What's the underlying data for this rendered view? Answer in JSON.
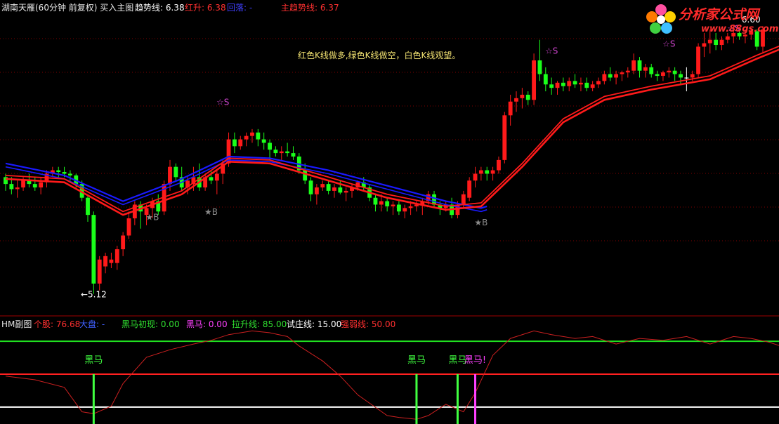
{
  "header": {
    "title": "湖南天雁(60分钟 前复权) 买入主图",
    "trend_label": "趋势线: 6.38",
    "red_up_label": "红升: 6.38",
    "fall_label": "回落: -",
    "main_trend_label": "主趋势线: 6.37"
  },
  "logo": {
    "text": "分析家公式网",
    "url": "www.88gs.com"
  },
  "annotation": "红色K线做多,绿色K线做空，白色K线观望。",
  "sub_header": {
    "title": "HM副图",
    "stock": "个股: 76.68",
    "market": "大盘: -",
    "first_appear": "黑马初现: 0.00",
    "dark_horse": "黑马: 0.00",
    "pull_up": "拉升线: 85.00",
    "test_zhuang": "试庄线: 15.00",
    "strength": "强弱线: 50.00"
  },
  "colors": {
    "up": "#ff1a1a",
    "down": "#1aff1a",
    "neutral": "#ffffff",
    "trend": "#1a1aff",
    "main_trend": "#ff1a1a",
    "grid": "#800000",
    "signal": "#cc44cc",
    "buy_mark": "#8a8a8a",
    "strength_line": "#cc2020",
    "level_high": "#20e020",
    "level_mid": "#ff2020",
    "level_low": "#ffffff",
    "dark_horse_signal": "#40ff40",
    "dark_horse_bang": "#ff40ff"
  },
  "chart_data": [
    {
      "type": "candlestick",
      "name": "main",
      "ylim": [
        5.0,
        6.75
      ],
      "ohlc": [
        [
          5.8,
          5.82,
          5.72,
          5.76
        ],
        [
          5.76,
          5.8,
          5.7,
          5.73
        ],
        [
          5.73,
          5.78,
          5.68,
          5.74
        ],
        [
          5.74,
          5.8,
          5.72,
          5.78
        ],
        [
          5.78,
          5.82,
          5.74,
          5.76
        ],
        [
          5.76,
          5.8,
          5.72,
          5.74
        ],
        [
          5.74,
          5.8,
          5.7,
          5.77
        ],
        [
          5.77,
          5.84,
          5.74,
          5.82
        ],
        [
          5.82,
          5.86,
          5.8,
          5.84
        ],
        [
          5.84,
          5.86,
          5.8,
          5.83
        ],
        [
          5.83,
          5.86,
          5.8,
          5.82
        ],
        [
          5.82,
          5.84,
          5.78,
          5.81
        ],
        [
          5.81,
          5.82,
          5.74,
          5.76
        ],
        [
          5.76,
          5.78,
          5.66,
          5.68
        ],
        [
          5.68,
          5.7,
          5.54,
          5.58
        ],
        [
          5.58,
          5.6,
          5.12,
          5.18
        ],
        [
          5.18,
          5.34,
          5.14,
          5.32
        ],
        [
          5.28,
          5.36,
          5.24,
          5.34
        ],
        [
          5.3,
          5.36,
          5.27,
          5.32
        ],
        [
          5.3,
          5.4,
          5.26,
          5.38
        ],
        [
          5.38,
          5.48,
          5.34,
          5.46
        ],
        [
          5.46,
          5.6,
          5.44,
          5.56
        ],
        [
          5.56,
          5.66,
          5.52,
          5.64
        ],
        [
          5.64,
          5.66,
          5.5,
          5.6
        ],
        [
          5.58,
          5.64,
          5.52,
          5.62
        ],
        [
          5.62,
          5.68,
          5.56,
          5.66
        ],
        [
          5.66,
          5.7,
          5.58,
          5.6
        ],
        [
          5.6,
          5.78,
          5.58,
          5.76
        ],
        [
          5.76,
          5.9,
          5.72,
          5.86
        ],
        [
          5.86,
          5.88,
          5.78,
          5.8
        ],
        [
          5.8,
          5.86,
          5.72,
          5.74
        ],
        [
          5.74,
          5.8,
          5.7,
          5.78
        ],
        [
          5.76,
          5.86,
          5.72,
          5.8
        ],
        [
          5.8,
          5.88,
          5.72,
          5.74
        ],
        [
          5.74,
          5.82,
          5.72,
          5.8
        ],
        [
          5.8,
          5.84,
          5.76,
          5.78
        ],
        [
          5.78,
          5.84,
          5.7,
          5.82
        ],
        [
          5.82,
          5.9,
          5.76,
          5.88
        ],
        [
          5.88,
          6.06,
          5.86,
          6.02
        ],
        [
          6.02,
          6.06,
          5.94,
          5.98
        ],
        [
          5.98,
          6.04,
          5.96,
          6.02
        ],
        [
          6.02,
          6.06,
          5.98,
          6.04
        ],
        [
          6.04,
          6.08,
          6.0,
          6.06
        ],
        [
          6.06,
          6.08,
          5.98,
          6.02
        ],
        [
          6.02,
          6.06,
          5.96,
          6.0
        ],
        [
          6.0,
          6.02,
          5.9,
          5.96
        ],
        [
          5.96,
          5.98,
          5.92,
          5.94
        ],
        [
          5.94,
          5.98,
          5.9,
          5.95
        ],
        [
          5.95,
          6.0,
          5.92,
          5.94
        ],
        [
          5.94,
          5.98,
          5.9,
          5.92
        ],
        [
          5.92,
          5.94,
          5.82,
          5.84
        ],
        [
          5.84,
          5.88,
          5.76,
          5.78
        ],
        [
          5.78,
          5.8,
          5.66,
          5.7
        ],
        [
          5.7,
          5.76,
          5.64,
          5.74
        ],
        [
          5.74,
          5.78,
          5.72,
          5.76
        ],
        [
          5.76,
          5.78,
          5.7,
          5.72
        ],
        [
          5.72,
          5.76,
          5.68,
          5.74
        ],
        [
          5.74,
          5.78,
          5.7,
          5.71
        ],
        [
          5.71,
          5.74,
          5.66,
          5.72
        ],
        [
          5.72,
          5.76,
          5.68,
          5.74
        ],
        [
          5.74,
          5.78,
          5.72,
          5.77
        ],
        [
          5.77,
          5.8,
          5.72,
          5.74
        ],
        [
          5.74,
          5.76,
          5.66,
          5.68
        ],
        [
          5.68,
          5.7,
          5.6,
          5.64
        ],
        [
          5.64,
          5.7,
          5.6,
          5.66
        ],
        [
          5.66,
          5.68,
          5.6,
          5.63
        ],
        [
          5.63,
          5.66,
          5.58,
          5.64
        ],
        [
          5.64,
          5.66,
          5.58,
          5.6
        ],
        [
          5.6,
          5.64,
          5.56,
          5.62
        ],
        [
          5.62,
          5.66,
          5.58,
          5.63
        ],
        [
          5.63,
          5.66,
          5.6,
          5.64
        ],
        [
          5.64,
          5.68,
          5.58,
          5.66
        ],
        [
          5.66,
          5.72,
          5.64,
          5.7
        ],
        [
          5.7,
          5.72,
          5.62,
          5.64
        ],
        [
          5.64,
          5.66,
          5.58,
          5.62
        ],
        [
          5.62,
          5.66,
          5.6,
          5.64
        ],
        [
          5.64,
          5.68,
          5.56,
          5.58
        ],
        [
          5.58,
          5.66,
          5.56,
          5.64
        ],
        [
          5.64,
          5.72,
          5.62,
          5.7
        ],
        [
          5.68,
          5.8,
          5.66,
          5.78
        ],
        [
          5.78,
          5.86,
          5.74,
          5.82
        ],
        [
          5.82,
          5.86,
          5.78,
          5.84
        ],
        [
          5.84,
          5.86,
          5.78,
          5.82
        ],
        [
          5.82,
          5.86,
          5.78,
          5.84
        ],
        [
          5.84,
          5.92,
          5.82,
          5.9
        ],
        [
          5.9,
          6.18,
          5.88,
          6.16
        ],
        [
          6.16,
          6.28,
          6.1,
          6.24
        ],
        [
          6.24,
          6.3,
          6.18,
          6.26
        ],
        [
          6.26,
          6.32,
          6.2,
          6.28
        ],
        [
          6.28,
          6.3,
          6.22,
          6.25
        ],
        [
          6.25,
          6.52,
          6.22,
          6.48
        ],
        [
          6.48,
          6.6,
          6.36,
          6.4
        ],
        [
          6.4,
          6.44,
          6.3,
          6.34
        ],
        [
          6.34,
          6.38,
          6.28,
          6.32
        ],
        [
          6.32,
          6.36,
          6.28,
          6.35
        ],
        [
          6.35,
          6.38,
          6.3,
          6.33
        ],
        [
          6.33,
          6.38,
          6.3,
          6.36
        ],
        [
          6.36,
          6.4,
          6.32,
          6.34
        ],
        [
          6.34,
          6.38,
          6.3,
          6.35
        ],
        [
          6.35,
          6.38,
          6.3,
          6.32
        ],
        [
          6.32,
          6.36,
          6.3,
          6.34
        ],
        [
          6.34,
          6.38,
          6.32,
          6.36
        ],
        [
          6.36,
          6.42,
          6.34,
          6.4
        ],
        [
          6.4,
          6.44,
          6.36,
          6.38
        ],
        [
          6.38,
          6.42,
          6.34,
          6.4
        ],
        [
          6.4,
          6.42,
          6.36,
          6.41
        ],
        [
          6.41,
          6.44,
          6.38,
          6.42
        ],
        [
          6.42,
          6.52,
          6.4,
          6.48
        ],
        [
          6.48,
          6.5,
          6.38,
          6.42
        ],
        [
          6.42,
          6.46,
          6.38,
          6.44
        ],
        [
          6.44,
          6.46,
          6.38,
          6.4
        ],
        [
          6.4,
          6.42,
          6.36,
          6.39
        ],
        [
          6.39,
          6.42,
          6.36,
          6.41
        ],
        [
          6.41,
          6.44,
          6.38,
          6.42
        ],
        [
          6.42,
          6.44,
          6.36,
          6.4
        ],
        [
          6.4,
          6.42,
          6.34,
          6.38
        ],
        [
          6.38,
          6.44,
          6.3,
          6.38
        ],
        [
          6.38,
          6.42,
          6.36,
          6.4
        ],
        [
          6.4,
          6.58,
          6.38,
          6.56
        ],
        [
          6.56,
          6.64,
          6.5,
          6.58
        ],
        [
          6.58,
          6.66,
          6.52,
          6.6
        ],
        [
          6.6,
          6.64,
          6.54,
          6.57
        ],
        [
          6.57,
          6.62,
          6.54,
          6.6
        ],
        [
          6.6,
          6.64,
          6.58,
          6.62
        ],
        [
          6.62,
          6.68,
          6.58,
          6.64
        ],
        [
          6.64,
          6.66,
          6.6,
          6.62
        ],
        [
          6.62,
          6.66,
          6.58,
          6.63
        ],
        [
          6.63,
          6.67,
          6.6,
          6.65
        ],
        [
          6.65,
          6.66,
          6.54,
          6.56
        ],
        [
          6.56,
          6.68,
          6.52,
          6.66
        ]
      ],
      "trend_line": [
        [
          0,
          5.88
        ],
        [
          10,
          5.81
        ],
        [
          20,
          5.66
        ],
        [
          30,
          5.79
        ],
        [
          38,
          5.92
        ],
        [
          45,
          5.91
        ],
        [
          55,
          5.84
        ],
        [
          65,
          5.75
        ],
        [
          75,
          5.66
        ],
        [
          81,
          5.62
        ],
        [
          82,
          5.63
        ]
      ],
      "main_trend_line": [
        [
          0,
          5.79
        ],
        [
          10,
          5.77
        ],
        [
          20,
          5.58
        ],
        [
          30,
          5.7
        ],
        [
          38,
          5.89
        ],
        [
          45,
          5.88
        ],
        [
          55,
          5.78
        ],
        [
          65,
          5.68
        ],
        [
          75,
          5.61
        ],
        [
          81,
          5.63
        ],
        [
          88,
          5.86
        ],
        [
          95,
          6.12
        ],
        [
          102,
          6.25
        ],
        [
          110,
          6.31
        ],
        [
          120,
          6.37
        ],
        [
          128,
          6.49
        ],
        [
          133,
          6.56
        ]
      ],
      "labels": [
        {
          "text": "☆S",
          "index": 37,
          "y": 6.22,
          "color": "signal"
        },
        {
          "text": "☆S",
          "index": 93,
          "y": 6.52,
          "color": "signal"
        },
        {
          "text": "☆S",
          "index": 113,
          "y": 6.56,
          "color": "signal"
        },
        {
          "text": "☆S",
          "index": 124,
          "y": 6.65,
          "color": "signal"
        },
        {
          "text": "★B",
          "index": 25,
          "y": 5.55,
          "color": "buy_mark"
        },
        {
          "text": "★B",
          "index": 35,
          "y": 5.58,
          "color": "buy_mark"
        },
        {
          "text": "★B",
          "index": 81,
          "y": 5.52,
          "color": "buy_mark"
        },
        {
          "text": "←5.12",
          "index": 15,
          "y": 5.1,
          "color": "neutral"
        },
        {
          "text": "6.60",
          "index": 127,
          "y": 6.7,
          "color": "neutral"
        }
      ]
    },
    {
      "type": "line",
      "name": "HM副图",
      "ylim": [
        0,
        100
      ],
      "levels": [
        85,
        50,
        15
      ],
      "strength_line": [
        [
          0,
          48
        ],
        [
          5,
          44
        ],
        [
          10,
          36
        ],
        [
          13,
          10
        ],
        [
          15,
          8
        ],
        [
          18,
          16
        ],
        [
          20,
          40
        ],
        [
          24,
          68
        ],
        [
          28,
          76
        ],
        [
          32,
          82
        ],
        [
          35,
          86
        ],
        [
          38,
          92
        ],
        [
          42,
          96
        ],
        [
          45,
          94
        ],
        [
          48,
          90
        ],
        [
          50,
          80
        ],
        [
          54,
          64
        ],
        [
          57,
          48
        ],
        [
          60,
          28
        ],
        [
          65,
          6
        ],
        [
          67,
          4
        ],
        [
          70,
          2
        ],
        [
          72,
          6
        ],
        [
          75,
          18
        ],
        [
          78,
          10
        ],
        [
          80,
          30
        ],
        [
          83,
          70
        ],
        [
          86,
          88
        ],
        [
          90,
          96
        ],
        [
          93,
          92
        ],
        [
          97,
          88
        ],
        [
          100,
          90
        ],
        [
          104,
          82
        ],
        [
          108,
          88
        ],
        [
          112,
          86
        ],
        [
          116,
          90
        ],
        [
          120,
          82
        ],
        [
          124,
          90
        ],
        [
          127,
          88
        ],
        [
          130,
          84
        ],
        [
          133,
          78
        ],
        [
          134,
          86
        ]
      ],
      "signals": [
        {
          "text": "黑马",
          "index": 15,
          "color": "dark_horse_signal"
        },
        {
          "text": "黑马",
          "index": 70,
          "color": "dark_horse_signal"
        },
        {
          "text": "黑马",
          "index": 77,
          "color": "dark_horse_signal"
        },
        {
          "text": "黑马!",
          "index": 80,
          "color": "dark_horse_bang"
        }
      ]
    }
  ]
}
